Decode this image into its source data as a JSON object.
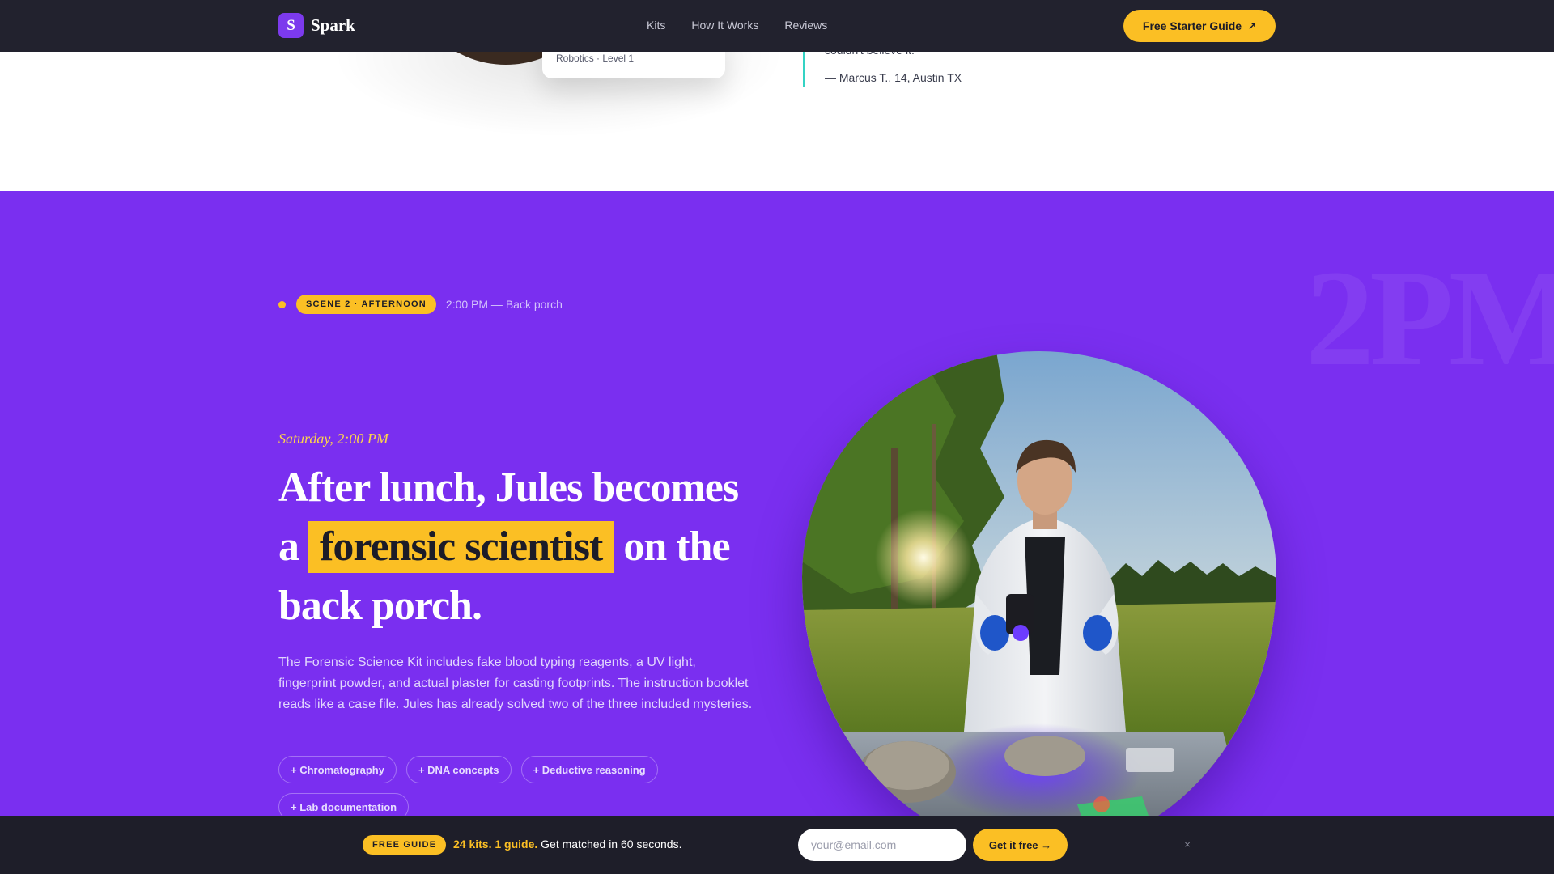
{
  "nav": {
    "logo_letter": "S",
    "brand": "Spark",
    "links": [
      "Kits",
      "How It Works",
      "Reviews"
    ],
    "cta_label": "Free Starter Guide",
    "cta_icon": "arrow-up-right-icon"
  },
  "previous_section": {
    "kit_card_meta": "Robotics · Level 1",
    "quote_text": "couldn't believe it.",
    "quote_author": "— Marcus T., 14, Austin TX"
  },
  "scene": {
    "watermark": "2PM",
    "badge": "SCENE 2 · AFTERNOON",
    "meta": "2:00 PM — Back porch",
    "time": "Saturday, 2:00 PM",
    "headline_before": "After lunch, Jules becomes a",
    "headline_highlight": "forensic scientist",
    "headline_after": "on the back porch.",
    "body": "The Forensic Science Kit includes fake blood typing reagents, a UV light, fingerprint powder, and actual plaster for casting footprints. The instruction booklet reads like a case file. Jules has already solved two of the three included mysteries.",
    "chips": [
      "+ Chromatography",
      "+ DNA concepts",
      "+ Deductive reasoning",
      "+ Lab documentation"
    ]
  },
  "lead_bar": {
    "badge": "FREE GUIDE",
    "highlight": "24 kits. 1 guide.",
    "text": "Get matched in 60 seconds.",
    "email_placeholder": "your@email.com",
    "submit_label": "Get it free →",
    "close_label": "×"
  },
  "colors": {
    "nav_bg": "#22222e",
    "accent_yellow": "#fbbf24",
    "scene_purple": "#7a2ff0",
    "quote_border": "#34d3c4",
    "lead_bar_bg": "#1e1e29"
  }
}
